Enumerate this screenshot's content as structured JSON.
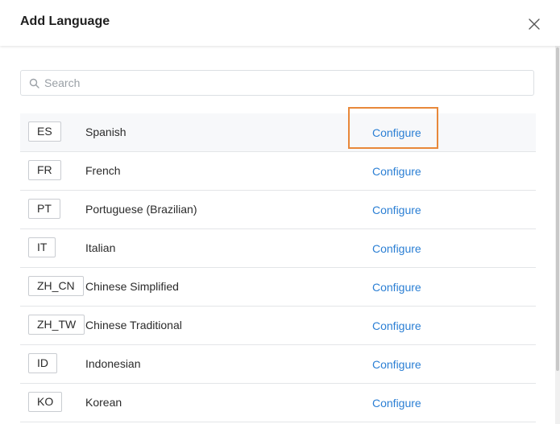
{
  "dialog": {
    "title": "Add Language",
    "close_icon": "close-icon"
  },
  "search": {
    "icon": "search-icon",
    "placeholder": "Search",
    "value": ""
  },
  "colors": {
    "link": "#2b7fd4",
    "focus_outline": "#e8883a",
    "row_highlight": "#f7f8fa"
  },
  "languages": [
    {
      "code": "ES",
      "name": "Spanish",
      "action": "Configure"
    },
    {
      "code": "FR",
      "name": "French",
      "action": "Configure"
    },
    {
      "code": "PT",
      "name": "Portuguese (Brazilian)",
      "action": "Configure"
    },
    {
      "code": "IT",
      "name": "Italian",
      "action": "Configure"
    },
    {
      "code": "ZH_CN",
      "name": "Chinese Simplified",
      "action": "Configure"
    },
    {
      "code": "ZH_TW",
      "name": "Chinese Traditional",
      "action": "Configure"
    },
    {
      "code": "ID",
      "name": "Indonesian",
      "action": "Configure"
    },
    {
      "code": "KO",
      "name": "Korean",
      "action": "Configure"
    }
  ]
}
